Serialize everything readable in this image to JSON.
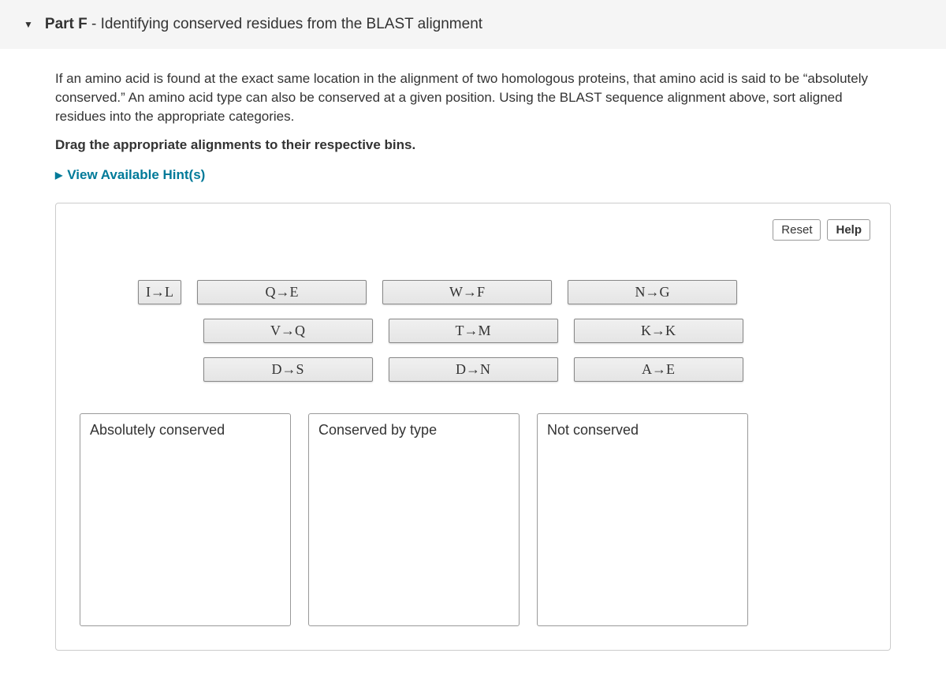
{
  "header": {
    "part_label": "Part F",
    "separator": " - ",
    "title": "Identifying conserved residues from the BLAST alignment"
  },
  "description": "If an amino acid is found at the exact same location in the alignment of two homologous proteins, that amino acid is said to be “absolutely conserved.” An amino acid type can also be conserved at a given position. Using the BLAST sequence alignment above, sort aligned residues into the appropriate categories.",
  "instruction": "Drag the appropriate alignments to their respective bins.",
  "hints_label": "View Available Hint(s)",
  "buttons": {
    "reset": "Reset",
    "help": "Help"
  },
  "items": {
    "row1": [
      {
        "label": "I→L",
        "class": "narrow"
      },
      {
        "label": "Q→E",
        "class": "wide"
      },
      {
        "label": "W→F",
        "class": "wide"
      },
      {
        "label": "N→G",
        "class": "wide"
      }
    ],
    "row2": [
      {
        "label": "V→Q",
        "class": "wide"
      },
      {
        "label": "T→M",
        "class": "wide"
      },
      {
        "label": "K→K",
        "class": "wide"
      }
    ],
    "row3": [
      {
        "label": "D→S",
        "class": "wide"
      },
      {
        "label": "D→N",
        "class": "wide"
      },
      {
        "label": "A→E",
        "class": "wide"
      }
    ]
  },
  "bins": [
    {
      "label": "Absolutely conserved"
    },
    {
      "label": "Conserved by type"
    },
    {
      "label": "Not conserved"
    }
  ]
}
